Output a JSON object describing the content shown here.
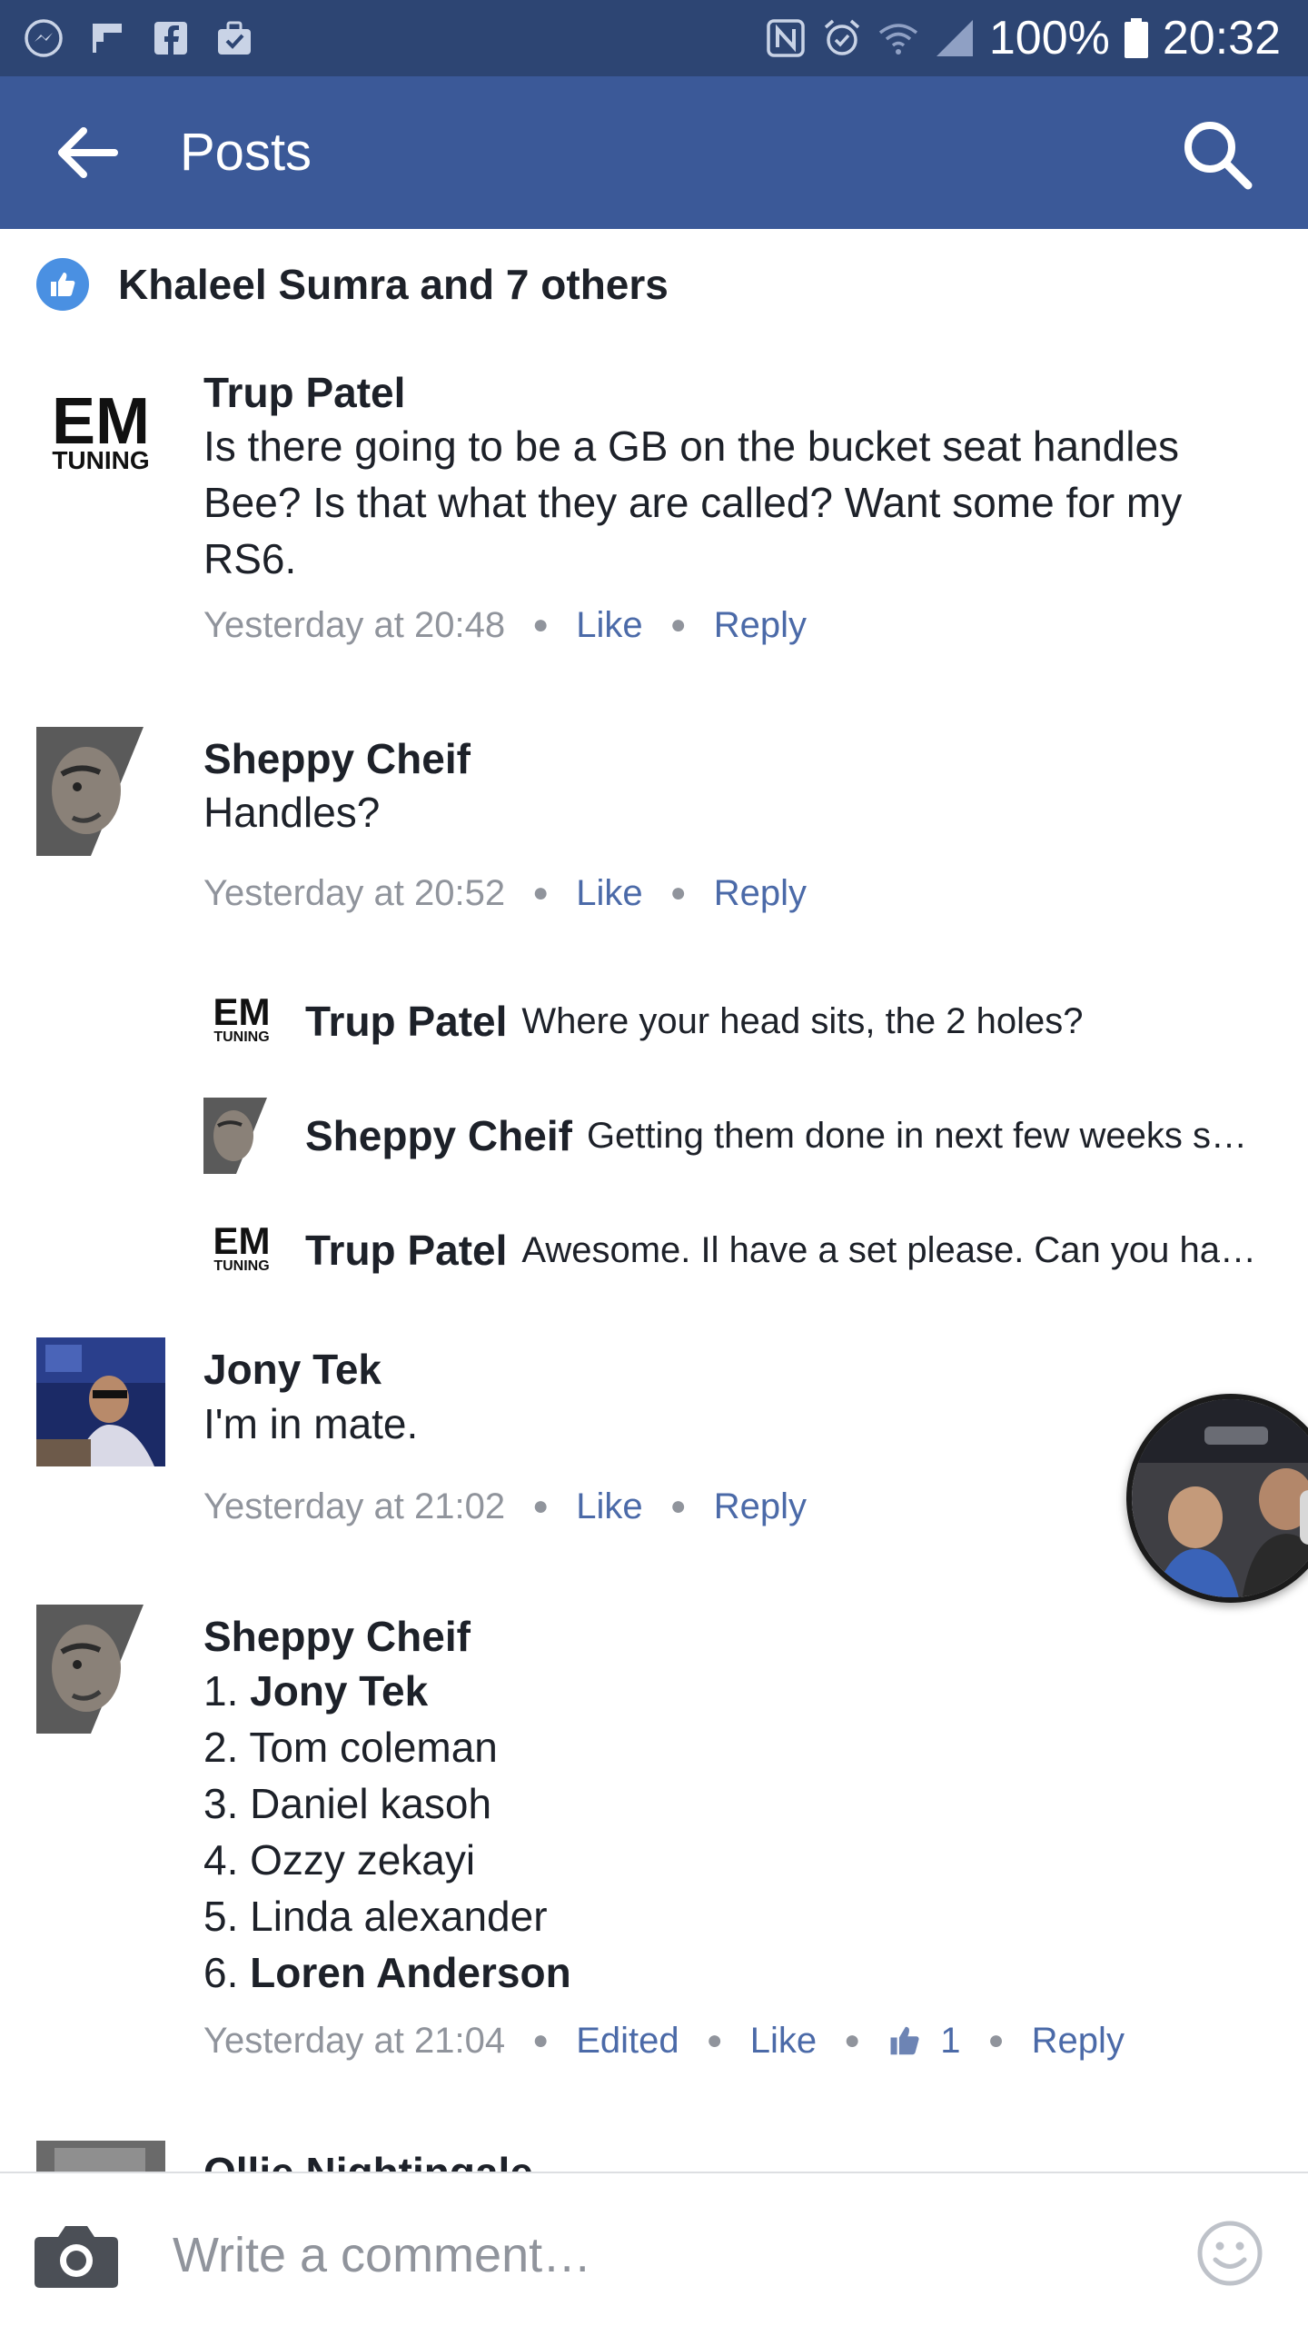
{
  "status_bar": {
    "battery": "100%",
    "time": "20:32",
    "icons": [
      "messenger-icon",
      "flipboard-icon",
      "facebook-icon",
      "briefcase-icon",
      "nfc-icon",
      "alarm-icon",
      "wifi-icon",
      "signal-icon",
      "battery-icon"
    ]
  },
  "header": {
    "title": "Posts",
    "back_icon": "arrow-left-icon",
    "search_icon": "search-icon",
    "background": "#3b5998"
  },
  "likes": {
    "text": "Khaleel Sumra and 7 others",
    "icon": "thumbs-up-icon",
    "color": "#4a90e2"
  },
  "comments": [
    {
      "author": "Trup Patel",
      "avatar_text": {
        "big": "EM",
        "small": "TUNING"
      },
      "text": "Is there going to be a GB on the bucket seat handles Bee? Is that what they are called? Want some for my RS6.",
      "time": "Yesterday at 20:48",
      "like": "Like",
      "reply": "Reply"
    },
    {
      "author": "Sheppy Cheif",
      "text": "Handles?",
      "time": "Yesterday at 20:52",
      "like": "Like",
      "reply": "Reply",
      "replies": [
        {
          "author": "Trup Patel",
          "text": "Where your head sits, the 2 holes?",
          "avatar_text": {
            "big": "EM",
            "small": "TUNING"
          }
        },
        {
          "author": "Sheppy Cheif",
          "text": "Getting them done in next few weeks s…"
        },
        {
          "author": "Trup Patel",
          "text": "Awesome. Il have a set please. Can you ha…",
          "avatar_text": {
            "big": "EM",
            "small": "TUNING"
          }
        }
      ]
    },
    {
      "author": "Jony Tek",
      "text": "I'm in mate.",
      "time": "Yesterday at 21:02",
      "like": "Like",
      "reply": "Reply"
    },
    {
      "author": "Sheppy Cheif",
      "list": [
        {
          "num": "1.",
          "name": "Jony Tek"
        },
        {
          "num": "2.",
          "name": "Tom coleman"
        },
        {
          "num": "3.",
          "name": "Daniel kasoh"
        },
        {
          "num": "4.",
          "name": "Ozzy zekayi"
        },
        {
          "num": "5.",
          "name": "Linda alexander"
        },
        {
          "num": "6.",
          "name": "Loren Anderson"
        }
      ],
      "time": "Yesterday at 21:04",
      "edited": "Edited",
      "like": "Like",
      "like_count": "1",
      "reply": "Reply"
    },
    {
      "author": "Ollie Nightingale"
    }
  ],
  "composer": {
    "placeholder": "Write a comment…",
    "camera_icon": "camera-icon",
    "emoji_icon": "emoji-icon"
  }
}
